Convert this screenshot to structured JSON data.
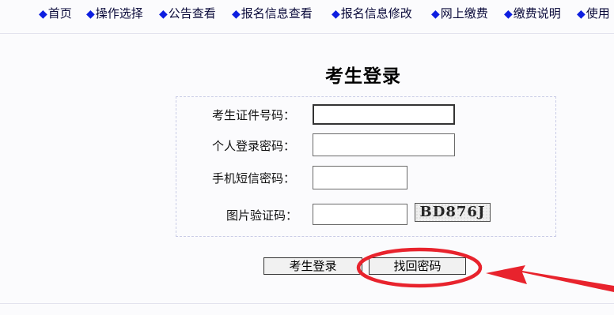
{
  "nav": {
    "items": [
      "首页",
      "操作选择",
      "公告查看",
      "报名信息查看",
      "报名信息修改",
      "网上缴费",
      "缴费说明",
      "使用"
    ]
  },
  "login": {
    "title": "考生登录",
    "fields": {
      "id_number": {
        "label": "考生证件号码：",
        "value": ""
      },
      "password": {
        "label": "个人登录密码：",
        "value": ""
      },
      "sms_code": {
        "label": "手机短信密码：",
        "value": ""
      },
      "captcha": {
        "label": "图片验证码：",
        "value": "",
        "image_text": "BD876J"
      }
    },
    "buttons": {
      "login": "考生登录",
      "recover": "找回密码"
    }
  },
  "colors": {
    "nav_diamond": "#0d1ee0",
    "annotation": "#e8232d"
  }
}
